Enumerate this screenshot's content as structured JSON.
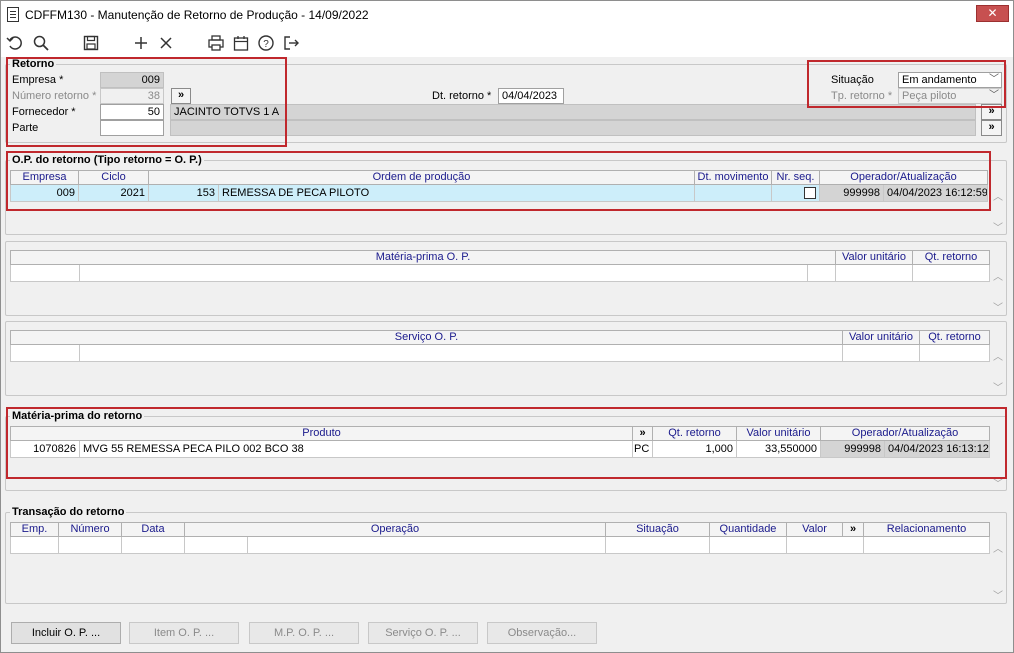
{
  "window": {
    "title": "CDFFM130 - Manutenção de Retorno de Produção - 14/09/2022",
    "close": "✕"
  },
  "toolbar": {
    "icons": [
      "undo-icon",
      "search-icon",
      "save-icon",
      "add-icon",
      "delete-icon",
      "print-icon",
      "calendar-icon",
      "help-icon",
      "exit-icon"
    ]
  },
  "retorno": {
    "title": "Retorno",
    "empresa_label": "Empresa *",
    "empresa_value": "009",
    "numero_label": "Número retorno *",
    "numero_value": "38",
    "fornecedor_label": "Fornecedor *",
    "fornecedor_value": "50",
    "fornecedor_name": "JACINTO TOTVS 1 A",
    "parte_label": "Parte",
    "parte_value": "",
    "dt_retorno_label": "Dt. retorno *",
    "dt_retorno_value": "04/04/2023",
    "situacao_label": "Situação",
    "situacao_value": "Em andamento",
    "tp_retorno_label": "Tp. retorno *",
    "tp_retorno_value": "Peça piloto",
    "more": "»"
  },
  "op_retorno": {
    "title": "O.P. do retorno (Tipo retorno = O. P.)",
    "headers": [
      "Empresa",
      "Ciclo",
      "Ordem de produção",
      "Dt. movimento",
      "Nr. seq.",
      "Operador/Atualização"
    ],
    "row": {
      "empresa": "009",
      "ciclo": "2021",
      "ordem_num": "153",
      "ordem_desc": "REMESSA DE PECA PILOTO",
      "dt_movimento": "",
      "nr_seq": "",
      "operador": "999998",
      "atualizacao": "04/04/2023 16:12:59"
    }
  },
  "mp_op": {
    "headers": [
      "Matéria-prima O. P.",
      "Valor unitário",
      "Qt. retorno"
    ]
  },
  "servico_op": {
    "headers": [
      "Serviço O. P.",
      "Valor unitário",
      "Qt. retorno"
    ]
  },
  "mp_retorno": {
    "title": "Matéria-prima do retorno",
    "headers": [
      "Produto",
      "»",
      "Qt. retorno",
      "Valor unitário",
      "Operador/Atualização"
    ],
    "row": {
      "codigo": "1070826",
      "descricao": "MVG 55 REMESSA PECA PILO 002 BCO 38",
      "unidade": "PC",
      "qt_retorno": "1,000",
      "valor_unitario": "33,550000",
      "operador": "999998",
      "atualizacao": "04/04/2023 16:13:12"
    }
  },
  "transacao": {
    "title": "Transação do retorno",
    "headers": [
      "Emp.",
      "Número",
      "Data",
      "Operação",
      "Situação",
      "Quantidade",
      "Valor",
      "»",
      "Relacionamento"
    ]
  },
  "buttons": {
    "incluir_op": "Incluir O. P. ...",
    "item_op": "Item O. P. ...",
    "mp_op": "M.P. O. P. ...",
    "servico_op": "Serviço O. P. ...",
    "observacao": "Observação..."
  }
}
